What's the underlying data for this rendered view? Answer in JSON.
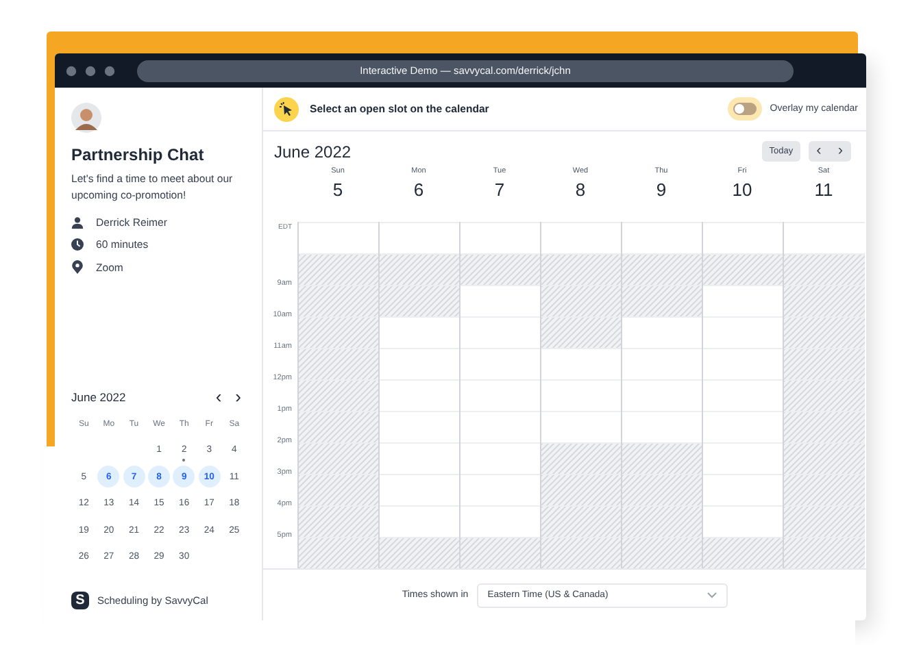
{
  "window": {
    "url": "Interactive Demo — savvycal.com/derrick/jchn"
  },
  "event": {
    "title": "Partnership Chat",
    "description": "Let's find a time to meet about our upcoming co-promotion!",
    "details": [
      {
        "kind": "person",
        "text": "Derrick Reimer"
      },
      {
        "kind": "clock",
        "text": "60 minutes"
      },
      {
        "kind": "pin",
        "text": "Zoom"
      }
    ]
  },
  "mini_calendar": {
    "month": "June 2022",
    "prev": "‹",
    "next": "›",
    "weekdays": [
      "Su",
      "Mo",
      "Tu",
      "We",
      "Th",
      "Fr",
      "Sa"
    ],
    "weeks": [
      [
        {
          "day": "1",
          "highlighted": false,
          "dot": false
        },
        {
          "day": "2",
          "highlighted": false,
          "dot": true
        },
        {
          "day": "3",
          "highlighted": false,
          "dot": false
        },
        {
          "day": "4",
          "highlighted": false,
          "dot": false
        }
      ],
      [
        {
          "day": "5",
          "highlighted": false,
          "dot": false
        },
        {
          "day": "6",
          "highlighted": true,
          "dot": false
        },
        {
          "day": "7",
          "highlighted": true,
          "dot": false
        },
        {
          "day": "8",
          "highlighted": true,
          "dot": false
        },
        {
          "day": "9",
          "highlighted": true,
          "dot": false
        },
        {
          "day": "10",
          "highlighted": true,
          "dot": false
        },
        {
          "day": "11",
          "highlighted": false,
          "dot": false
        }
      ],
      [
        {
          "day": "12",
          "highlighted": false,
          "dot": false
        },
        {
          "day": "13",
          "highlighted": false,
          "dot": false
        },
        {
          "day": "14",
          "highlighted": false,
          "dot": false
        },
        {
          "day": "15",
          "highlighted": false,
          "dot": false
        },
        {
          "day": "16",
          "highlighted": false,
          "dot": false
        },
        {
          "day": "17",
          "highlighted": false,
          "dot": false
        },
        {
          "day": "18",
          "highlighted": false,
          "dot": false
        }
      ],
      [
        {
          "day": "19",
          "highlighted": false,
          "dot": false
        },
        {
          "day": "20",
          "highlighted": false,
          "dot": false
        },
        {
          "day": "21",
          "highlighted": false,
          "dot": false
        },
        {
          "day": "22",
          "highlighted": false,
          "dot": false
        },
        {
          "day": "23",
          "highlighted": false,
          "dot": false
        },
        {
          "day": "24",
          "highlighted": false,
          "dot": false
        },
        {
          "day": "25",
          "highlighted": false,
          "dot": false
        }
      ],
      [
        {
          "day": "26",
          "highlighted": false,
          "dot": false
        },
        {
          "day": "27",
          "highlighted": false,
          "dot": false
        },
        {
          "day": "28",
          "highlighted": false,
          "dot": false
        },
        {
          "day": "29",
          "highlighted": false,
          "dot": false
        },
        {
          "day": "30",
          "highlighted": false,
          "dot": false
        }
      ]
    ]
  },
  "branding": {
    "logo": "S",
    "text": "Scheduling by SavvyCal"
  },
  "prompt": {
    "text": "Select an open slot on the calendar"
  },
  "overlay_toggle": {
    "label": "Overlay my calendar",
    "on": false
  },
  "calendar": {
    "month": "June 2022",
    "today_button": "Today",
    "prev": "‹",
    "next": "›",
    "timezone_abbr": "EDT",
    "time_labels": [
      "9am",
      "10am",
      "11am",
      "12pm",
      "1pm",
      "2pm",
      "3pm",
      "4pm",
      "5pm"
    ],
    "days": [
      {
        "weekday": "Sun",
        "date": "5",
        "open": [
          true,
          false,
          false,
          false,
          false,
          false,
          false,
          false,
          false,
          false,
          false
        ]
      },
      {
        "weekday": "Mon",
        "date": "6",
        "open": [
          true,
          false,
          false,
          true,
          true,
          true,
          true,
          true,
          true,
          true,
          false
        ]
      },
      {
        "weekday": "Tue",
        "date": "7",
        "open": [
          true,
          false,
          true,
          true,
          true,
          true,
          true,
          true,
          true,
          true,
          false
        ]
      },
      {
        "weekday": "Wed",
        "date": "8",
        "open": [
          true,
          false,
          false,
          false,
          true,
          true,
          true,
          false,
          false,
          false,
          false
        ]
      },
      {
        "weekday": "Thu",
        "date": "9",
        "open": [
          true,
          false,
          false,
          true,
          true,
          true,
          true,
          false,
          false,
          false,
          false
        ]
      },
      {
        "weekday": "Fri",
        "date": "10",
        "open": [
          true,
          false,
          true,
          true,
          true,
          true,
          true,
          true,
          true,
          true,
          false
        ]
      },
      {
        "weekday": "Sat",
        "date": "11",
        "open": [
          true,
          false,
          false,
          false,
          false,
          false,
          false,
          false,
          false,
          false,
          false
        ]
      }
    ]
  },
  "footer": {
    "label": "Times shown in",
    "timezone": "Eastern Time (US & Canada)"
  }
}
